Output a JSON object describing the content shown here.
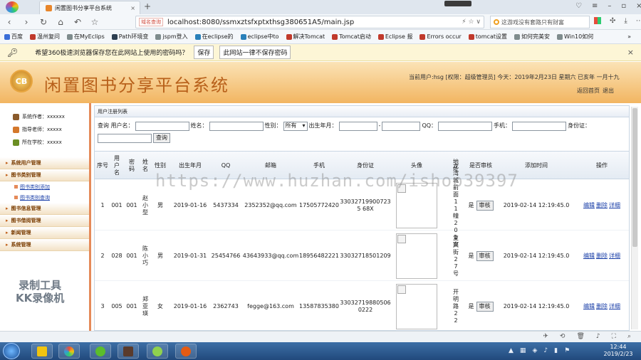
{
  "browser": {
    "tab_title": "闲置图书分享平台系统",
    "new_tab": "+",
    "url": "localhost:8080/ssmxztsfxptxthsg380651A5/main.jsp",
    "security_label": "域名查询",
    "search_placeholder": "这游戏没有套路只有财富",
    "bookmarks": [
      "百度",
      "温州复问",
      "在MyEclips",
      "Path环境变",
      "jspm登入",
      "在eclipse的",
      "eclipse中to",
      "解决Tomcat",
      "Tomcat启动",
      "Eclipse 报",
      "Errors occur",
      "tomcat设置",
      "如何完美安",
      "Win10如何"
    ],
    "password_prompt": "希望360极速浏览器保存您在此网站上使用的密码吗？",
    "save_btn": "保存",
    "never_save_btn": "此网站一律不保存密码"
  },
  "header": {
    "logo": "CB",
    "title": "闲置图书分享平台系统",
    "user_info": "当前用户:hsg [权限：超级管理员] 今天：2019年2月23日 星期六 已亥年 一月十九",
    "home_link": "返回首页",
    "logout_link": "退出"
  },
  "sidebar": {
    "info": [
      {
        "label": "系统作者：xxxxxx"
      },
      {
        "label": "指导老师：xxxxx"
      },
      {
        "label": "所在学校：xxxxx"
      }
    ],
    "menus": [
      {
        "label": "系统用户管理",
        "subitems": []
      },
      {
        "label": "图书类别管理",
        "subitems": [
          "图书类别添加",
          "图书类别查询"
        ]
      },
      {
        "label": "图书信息管理",
        "subitems": []
      },
      {
        "label": "图书借阅管理",
        "subitems": []
      },
      {
        "label": "新闻管理",
        "subitems": []
      },
      {
        "label": "系统管理",
        "subitems": []
      }
    ]
  },
  "main": {
    "section_title": "用户注册列表",
    "filters": {
      "query_label": "查询 用户名：",
      "name_label": "姓名：",
      "gender_label": "性别：",
      "gender_value": "所有",
      "birth_label": "出生年月：",
      "dash": "-",
      "qq_label": "QQ：",
      "phone_label": "手机：",
      "id_label": "身份证：",
      "search_btn": "查询"
    },
    "columns": [
      "序号",
      "用户名",
      "密码",
      "姓名",
      "性别",
      "出生年月",
      "QQ",
      "邮箱",
      "手机",
      "身份证",
      "头像",
      "地址",
      "是否审核",
      "添加时间",
      "操作"
    ],
    "audit_btn": "审核",
    "ops": [
      "编辑",
      "删除",
      "详细"
    ],
    "rows": [
      {
        "no": "1",
        "username": "001",
        "password": "001",
        "name": "赵小型",
        "gender": "男",
        "birth": "2019-01-16",
        "qq": "5437334",
        "email": "2352352@qq.com",
        "phone": "17505772420",
        "idcard": "330327199007235 68X",
        "address": "龙湾城前面11幢201室",
        "audited": "是",
        "added": "2019-02-14 12:19:45.0"
      },
      {
        "no": "2",
        "username": "028",
        "password": "001",
        "name": "陈小巧",
        "gender": "男",
        "birth": "2019-01-31",
        "qq": "25454766",
        "email": "43643933@qq.com",
        "phone": "18956482221",
        "idcard": "33032718501209",
        "address": "复兴街27号",
        "audited": "是",
        "added": "2019-02-14 12:19:45.0"
      },
      {
        "no": "3",
        "username": "005",
        "password": "001",
        "name": "郑亚瑛",
        "gender": "女",
        "birth": "2019-01-16",
        "qq": "2362743",
        "email": "fegge@163.com",
        "phone": "13587835380",
        "idcard": "330327198805060222",
        "address": "开明路22",
        "audited": "是",
        "added": "2019-02-14 12:19:45.0"
      }
    ]
  },
  "overlay": {
    "watermark": "https://www.huzhan.com/ishop39397",
    "recorder_line1": "录制工具",
    "recorder_line2": "KK录像机"
  },
  "taskbar": {
    "time": "12:44",
    "date": "2019/2/23"
  }
}
